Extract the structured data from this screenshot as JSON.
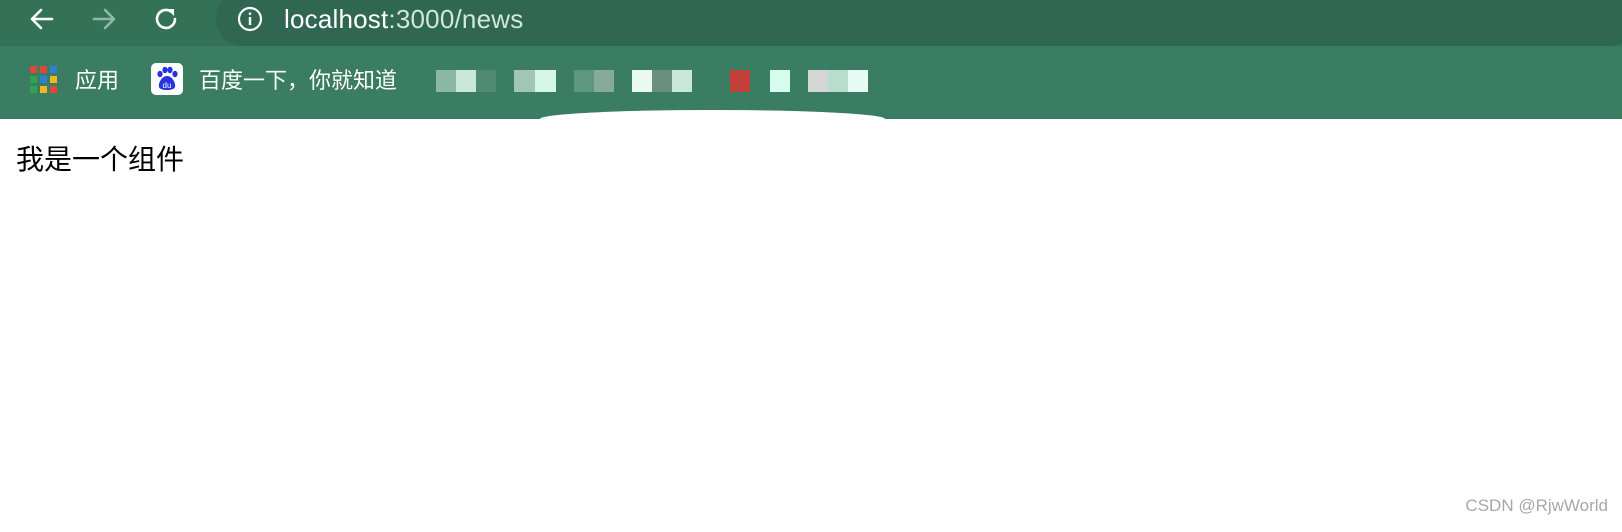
{
  "browser": {
    "url_host": "localhost",
    "url_path": ":3000/news",
    "bookmarks": [
      {
        "label": "应用",
        "icon": "apps-grid-icon"
      },
      {
        "label": "百度一下，你就知道",
        "icon": "baidu-paw-icon",
        "badge": "du"
      }
    ],
    "colors": {
      "toolbar": "#347257",
      "bookmarks_bar": "#3a7d62",
      "omnibox": "#2f6752"
    }
  },
  "page": {
    "content_text": "我是一个组件",
    "watermark": "CSDN @RjwWorld"
  }
}
